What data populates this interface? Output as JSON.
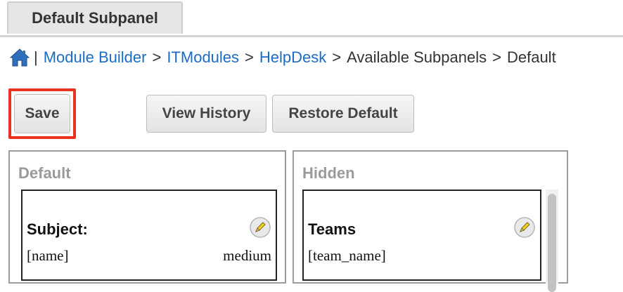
{
  "tab": {
    "label": "Default Subpanel"
  },
  "breadcrumb": {
    "separator_first": "|",
    "items": [
      {
        "label": "Module Builder",
        "link": true
      },
      {
        "label": "ITModules",
        "link": true
      },
      {
        "label": "HelpDesk",
        "link": true
      },
      {
        "label": "Available Subpanels",
        "link": false
      },
      {
        "label": "Default",
        "link": false
      }
    ],
    "separator": ">"
  },
  "toolbar": {
    "save_label": "Save",
    "view_history_label": "View History",
    "restore_default_label": "Restore Default"
  },
  "panels": {
    "default": {
      "title": "Default",
      "fields": [
        {
          "label": "Subject:",
          "name": "[name]",
          "width": "medium"
        }
      ]
    },
    "hidden": {
      "title": "Hidden",
      "fields": [
        {
          "label": "Teams",
          "name": "[team_name]",
          "width": ""
        }
      ]
    }
  },
  "colors": {
    "link": "#1a6cc7",
    "highlight": "#ea3223",
    "panel_title": "#9a9a9a",
    "home_icon": "#2f6fbd"
  },
  "icons": {
    "home": "home-icon",
    "edit": "pencil-edit-icon"
  }
}
